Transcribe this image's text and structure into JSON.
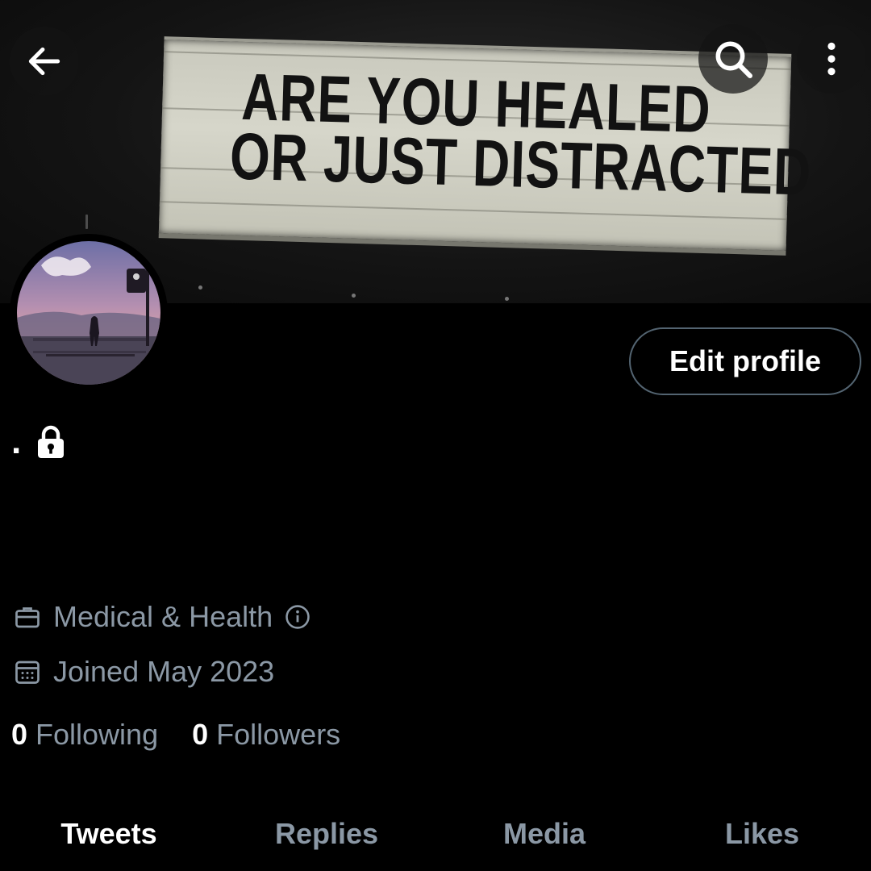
{
  "banner": {
    "sign_line1": "ARE YOU HEALED",
    "sign_line2": "OR JUST DISTRACTED"
  },
  "header": {
    "back_icon": "arrow-left-icon",
    "search_icon": "search-icon",
    "more_icon": "more-vertical-icon"
  },
  "profile": {
    "display_name": ".",
    "protected_icon": "lock-icon",
    "edit_label": "Edit profile",
    "category": "Medical & Health",
    "joined": "Joined May 2023",
    "following_count": "0",
    "following_label": "Following",
    "followers_count": "0",
    "followers_label": "Followers"
  },
  "tabs": [
    {
      "label": "Tweets",
      "active": true
    },
    {
      "label": "Replies",
      "active": false
    },
    {
      "label": "Media",
      "active": false
    },
    {
      "label": "Likes",
      "active": false
    }
  ],
  "colors": {
    "background": "#000000",
    "primary_text": "#e7e9ea",
    "secondary_text": "#8b98a5",
    "border": "#536471"
  }
}
